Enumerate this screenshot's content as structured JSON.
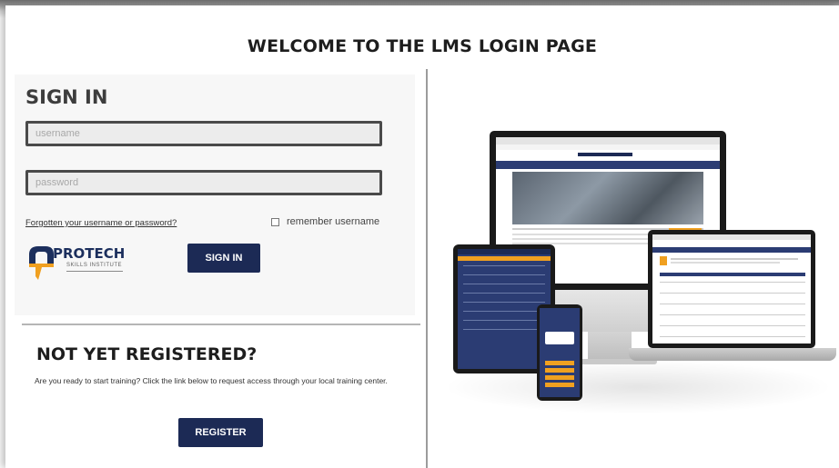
{
  "page": {
    "title": "WELCOME TO THE LMS LOGIN PAGE"
  },
  "signin": {
    "heading": "SIGN IN",
    "username_placeholder": "username",
    "password_placeholder": "password",
    "forgot_link": "Forgotten your username or password?",
    "remember_label": "remember username",
    "remember_checked": false,
    "button_label": "SIGN IN"
  },
  "logo": {
    "name": "PROTECH",
    "subtitle": "SKILLS INSTITUTE"
  },
  "register": {
    "heading": "NOT YET REGISTERED?",
    "text": "Are you ready to start training? Click the link below to request access through your local training center.",
    "button_label": "REGISTER"
  },
  "colors": {
    "accent_navy": "#1c2a55",
    "logo_orange": "#f0a020",
    "logo_navy": "#1c2f5d"
  },
  "icons": {
    "logo_mark": "protech-logo-icon"
  }
}
